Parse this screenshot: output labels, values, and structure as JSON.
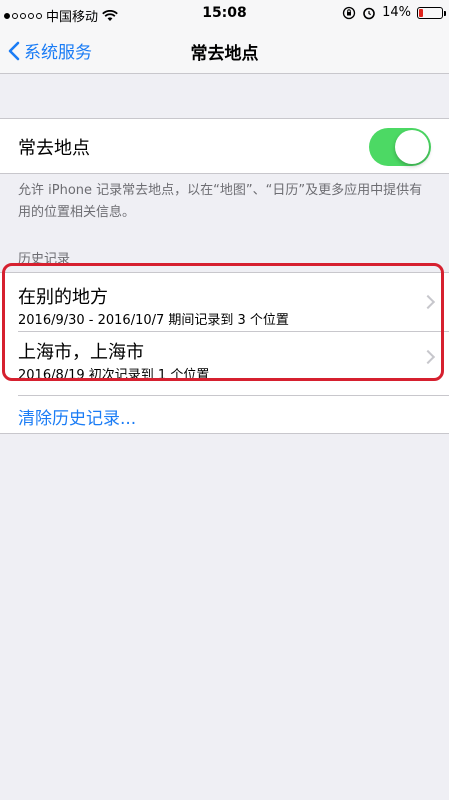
{
  "status_bar": {
    "carrier": "中国移动",
    "time": "15:08",
    "battery": "14%",
    "battery_level": 0.14
  },
  "nav": {
    "back_label": "系统服务",
    "title": "常去地点"
  },
  "setting": {
    "label": "常去地点",
    "toggle_on": true
  },
  "description": "允许 iPhone 记录常去地点，以在“地图”、“日历”及更多应用中提供有用的位置相关信息。",
  "history": {
    "header": "历史记录",
    "items": [
      {
        "title": "在别的地方",
        "subtitle": "2016/9/30 - 2016/10/7 期间记录到 3 个位置"
      },
      {
        "title": "上海市，上海市",
        "subtitle": "2016/8/19 初次记录到 1 个位置"
      }
    ],
    "clear_label": "清除历史记录..."
  },
  "colors": {
    "accent": "#1a7cf5",
    "toggle": "#4cd964",
    "highlight": "#d6202f"
  }
}
